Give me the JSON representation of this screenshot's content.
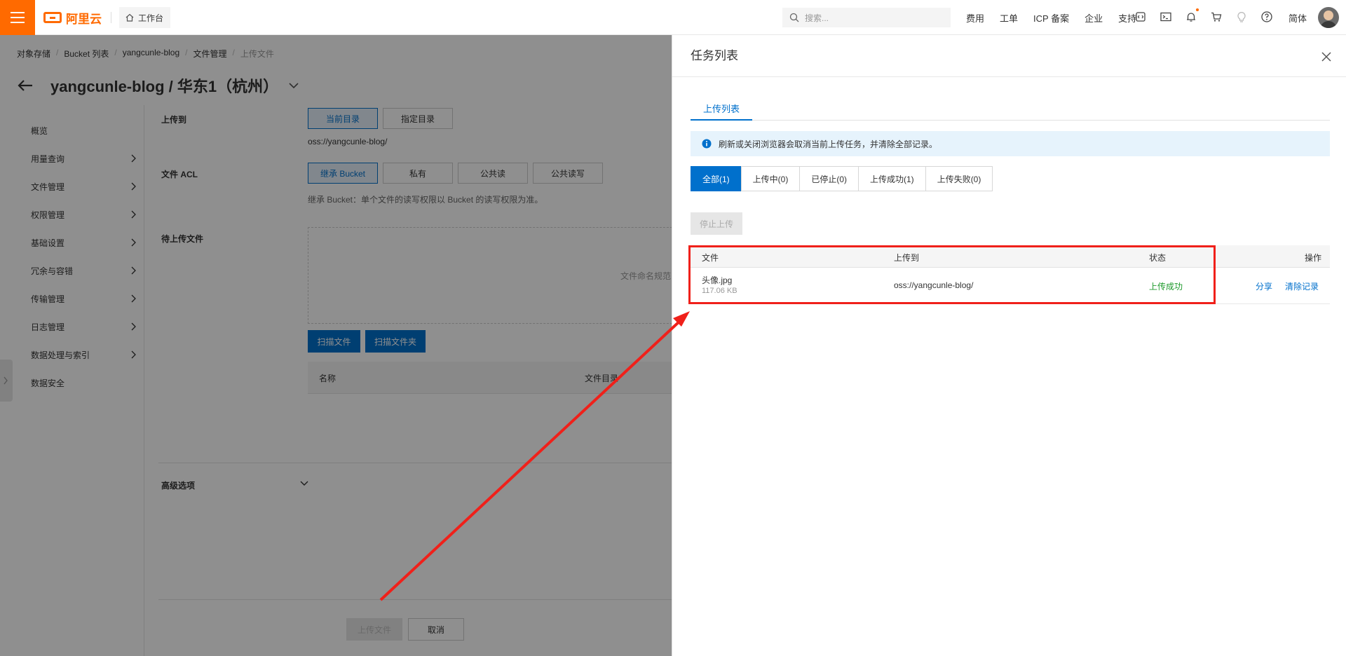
{
  "topbar": {
    "brand": "阿里云",
    "workbench": "工作台",
    "search_placeholder": "搜索...",
    "links": [
      "费用",
      "工单",
      "ICP 备案",
      "企业",
      "支持"
    ],
    "icons": [
      "code-icon",
      "terminal-icon",
      "bell-icon",
      "cart-icon",
      "lightbulb-icon",
      "help-icon"
    ],
    "lang": "简体",
    "accent_color": "#ff6a00"
  },
  "breadcrumb": [
    "对象存储",
    "Bucket 列表",
    "yangcunle-blog",
    "文件管理",
    "上传文件"
  ],
  "page": {
    "title": "yangcunle-blog / 华东1（杭州）"
  },
  "sidenav": [
    "概览",
    "用量查询",
    "文件管理",
    "权限管理",
    "基础设置",
    "冗余与容错",
    "传输管理",
    "日志管理",
    "数据处理与索引",
    "数据安全"
  ],
  "form": {
    "upload_to_label": "上传到",
    "dir_current": "当前目录",
    "dir_specified": "指定目录",
    "path": "oss://yangcunle-blog/",
    "acl_label": "文件 ACL",
    "acl_options": [
      "继承 Bucket",
      "私有",
      "公共读",
      "公共读写"
    ],
    "acl_hint": "继承 Bucket：单个文件的读写权限以 Bucket 的读写权限为准。",
    "pending_label": "待上传文件",
    "dropzone_text": "文件命名规范",
    "scan_file": "扫描文件",
    "scan_folder": "扫描文件夹",
    "table_headers": [
      "名称",
      "文件目录"
    ],
    "advanced_label": "高级选项",
    "upload_btn": "上传文件",
    "cancel_btn": "取消"
  },
  "drawer": {
    "title": "任务列表",
    "tab": "上传列表",
    "notice": "刷新或关闭浏览器会取消当前上传任务，并清除全部记录。",
    "filters": [
      "全部(1)",
      "上传中(0)",
      "已停止(0)",
      "上传成功(1)",
      "上传失败(0)"
    ],
    "stop_btn": "停止上传",
    "columns": [
      "文件",
      "上传到",
      "状态",
      "操作"
    ],
    "rows": [
      {
        "file": "头像.jpg",
        "size": "117.06 KB",
        "dest": "oss://yangcunle-blog/",
        "status": "上传成功",
        "action_share": "分享",
        "action_clear": "清除记录"
      }
    ],
    "primary_color": "#0070cc",
    "success_color": "#1e9a2c",
    "highlight_color": "#f0201a"
  }
}
